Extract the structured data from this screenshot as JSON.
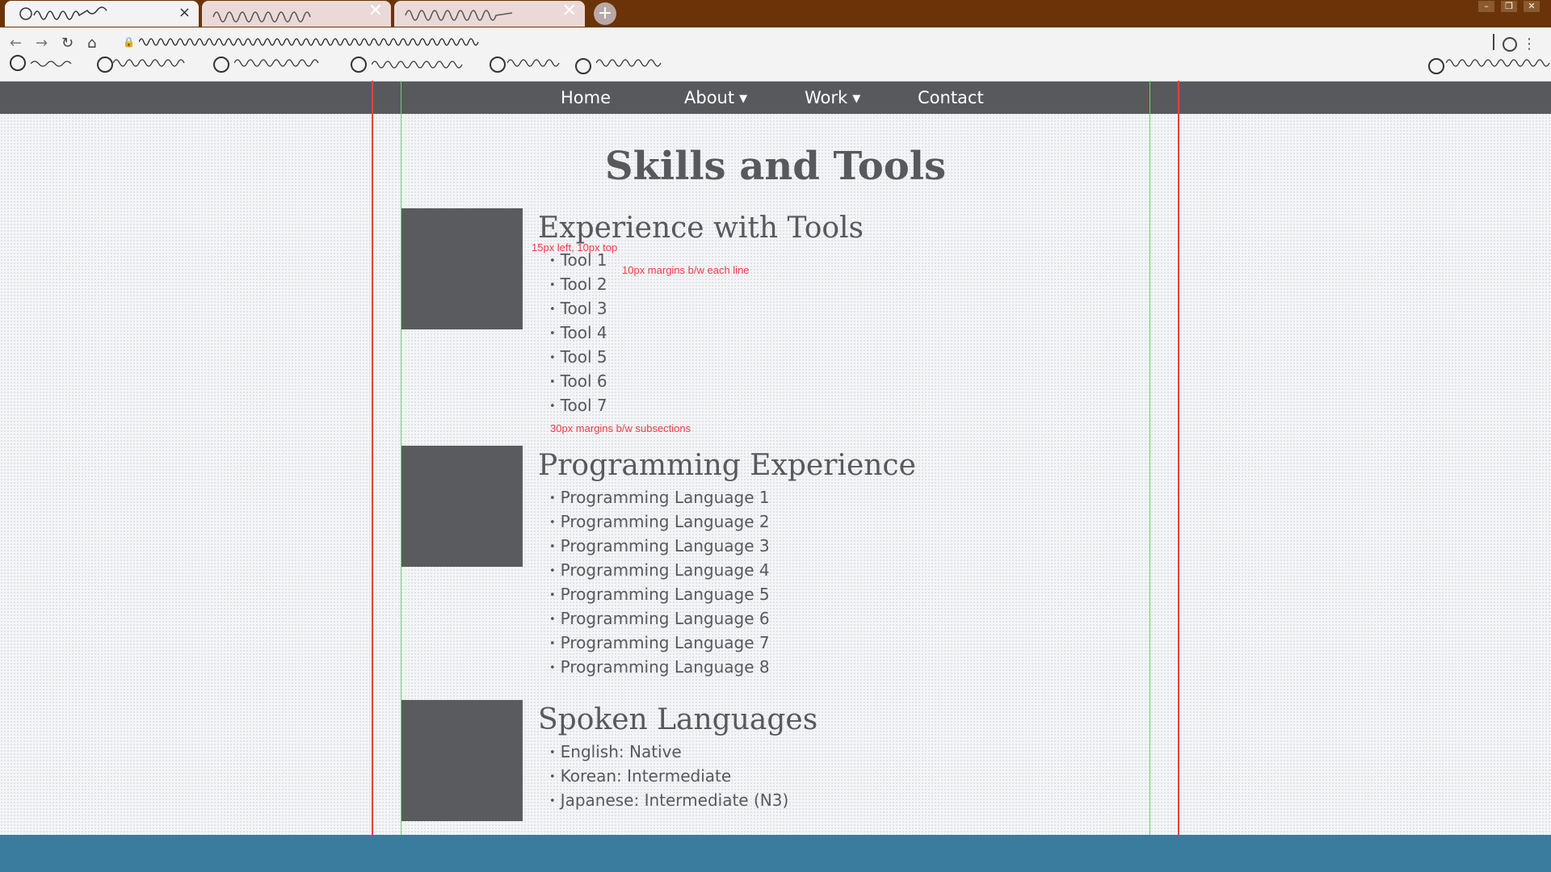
{
  "nav": {
    "links": [
      "Home",
      "About",
      "Work",
      "Contact"
    ]
  },
  "page_title": "Skills and Tools",
  "sections": [
    {
      "title": "Experience with Tools",
      "items": [
        "Tool 1",
        "Tool 2",
        "Tool 3",
        "Tool 4",
        "Tool 5",
        "Tool 6",
        "Tool 7"
      ]
    },
    {
      "title": "Programming Experience",
      "items": [
        "Programming Language 1",
        "Programming Language 2",
        "Programming Language 3",
        "Programming Language 4",
        "Programming Language 5",
        "Programming Language 6",
        "Programming Language 7",
        "Programming Language 8"
      ]
    },
    {
      "title": "Spoken Languages",
      "items": [
        "English: Native",
        "Korean: Intermediate",
        "Japanese: Intermediate (N3)"
      ]
    }
  ],
  "annotations": {
    "list_padding": "15px left, 10px top",
    "line_margin": "10px margins b/w each line",
    "subsection_margin": "30px margins b/w subsections"
  },
  "icons": {
    "back": "arrow-left",
    "forward": "arrow-right",
    "reload": "reload",
    "home": "home",
    "lock": "lock",
    "menu": "kebab-menu"
  },
  "colors": {
    "browser_frame": "#6a3308",
    "site_nav": "#58595d",
    "footer": "#3a7c9e",
    "guide_outer": "#e8413c",
    "guide_inner": "#6bd26b",
    "annotation": "#ef3b45"
  }
}
